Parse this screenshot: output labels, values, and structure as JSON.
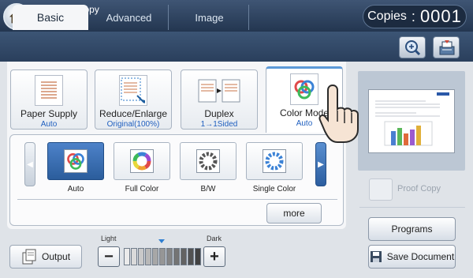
{
  "header": {
    "status": "Ready To Copy",
    "copies_label": "Copies",
    "copies_sep": ":",
    "copies_value": "0001"
  },
  "tabs": [
    {
      "label": "Basic",
      "active": true
    },
    {
      "label": "Advanced",
      "active": false
    },
    {
      "label": "Image",
      "active": false
    }
  ],
  "toolbar_icons": [
    "zoom-icon",
    "job-status-icon"
  ],
  "functions": [
    {
      "label": "Paper Supply",
      "value": "Auto",
      "icon": "paper-icon"
    },
    {
      "label": "Reduce/Enlarge",
      "value": "Original(100%)",
      "icon": "reduce-enlarge-icon"
    },
    {
      "label": "Duplex",
      "value": "1→1Sided",
      "icon": "duplex-icon"
    },
    {
      "label": "Color Mode",
      "value": "Auto",
      "icon": "color-mode-icon",
      "selected": true
    }
  ],
  "color_options": [
    {
      "label": "Auto",
      "selected": true
    },
    {
      "label": "Full Color",
      "selected": false
    },
    {
      "label": "B/W",
      "selected": false
    },
    {
      "label": "Single Color",
      "selected": false
    }
  ],
  "more_label": "more",
  "output_label": "Output",
  "density": {
    "light_label": "Light",
    "dark_label": "Dark",
    "minus": "−",
    "plus": "+",
    "level": 6,
    "steps": 11
  },
  "right_panel": {
    "proof_label": "Proof Copy",
    "programs_label": "Programs",
    "save_label": "Save Document"
  },
  "colors": {
    "accent": "#2f7fd1",
    "header": "#2a3f5c",
    "value_text": "#1f5fbf"
  }
}
